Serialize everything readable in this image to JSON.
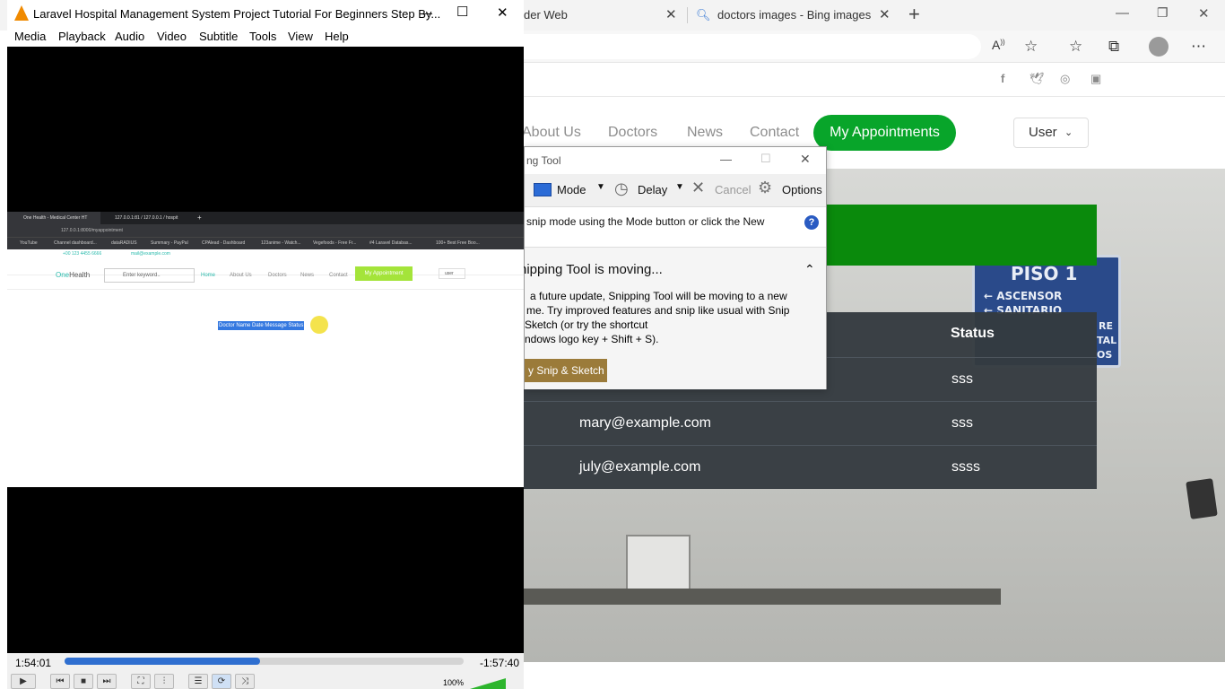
{
  "browser": {
    "tabs": [
      {
        "title": "der Web"
      },
      {
        "title": "doctors images - Bing images"
      }
    ],
    "site": {
      "nav": [
        "About Us",
        "Doctors",
        "News",
        "Contact"
      ],
      "my_appointments": "My Appointments",
      "user_label": "User",
      "table_header_status": "Status",
      "rows": [
        {
          "email": "",
          "status": "sss"
        },
        {
          "email": "mary@example.com",
          "status": "sss"
        },
        {
          "email": "july@example.com",
          "status": "ssss"
        }
      ],
      "sign_lines": [
        "PISO 1",
        "ASCENSOR",
        "SANITARIO",
        "RE",
        "TAL",
        "OS"
      ]
    }
  },
  "snip": {
    "title": "ng Tool",
    "mode": "Mode",
    "delay": "Delay",
    "cancel": "Cancel",
    "options": "Options",
    "info": "snip mode using the Mode button or click the New",
    "panel_title": "nipping Tool is moving...",
    "panel_lines": [
      "a future update, Snipping Tool will be moving to a new",
      "me. Try improved features and snip like usual with Snip",
      "Sketch (or try the shortcut",
      "ndows logo key + Shift + S)."
    ],
    "try_button": "y Snip & Sketch"
  },
  "vlc": {
    "title": "Laravel Hospital Management System Project Tutorial For Beginners Step By...",
    "menu": [
      "Media",
      "Playback",
      "Audio",
      "Video",
      "Subtitle",
      "Tools",
      "View",
      "Help"
    ],
    "time_elapsed": "1:54:01",
    "time_remaining": "-1:57:40",
    "progress": 0.49,
    "volume": "100%"
  },
  "mini": {
    "tab1": "One Health - Medical Center HT",
    "tab2": "127.0.0.1:81 / 127.0.0.1 / hospit",
    "url": "127.0.0.1:8000/myappointment",
    "bookmarks": [
      "YouTube",
      "Channel dashboard...",
      "dataRADIUS",
      "Summary - PayPal",
      "CPAlead - Dashboard",
      "123anime - Watch...",
      "Vegefoods - Free Fr...",
      "#4 Laravel Databas...",
      "100+ Best Free Boo..."
    ],
    "phone": "+00 123 4455 6666",
    "email": "mail@example.com",
    "logo_a": "One",
    "logo_b": "Health",
    "search_placeholder": "Enter keyword..",
    "nav": [
      "Home",
      "About Us",
      "Doctors",
      "News",
      "Contact"
    ],
    "my_appt": "My Appointment",
    "user": "user",
    "selected_text": "Doctor Name Date Message Status"
  }
}
